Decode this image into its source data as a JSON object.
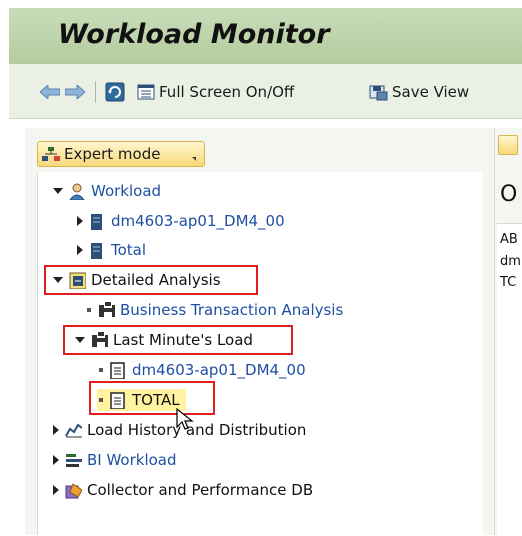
{
  "header": {
    "title": "Workload Monitor"
  },
  "toolbar": {
    "back_icon": "back-arrow-icon",
    "forward_icon": "forward-arrow-icon",
    "fullscreen_label": "Full Screen On/Off",
    "save_view_label": "Save View"
  },
  "expert_mode": {
    "label": "Expert mode"
  },
  "tree": {
    "workload": "Workload",
    "server": "dm4603-ap01_DM4_00",
    "total": "Total",
    "detailed_analysis": "Detailed Analysis",
    "business_transaction": "Business Transaction Analysis",
    "last_minute": "Last Minute's Load",
    "lm_server": "dm4603-ap01_DM4_00",
    "lm_total": "TOTAL",
    "load_history": "Load History and Distribution",
    "bi_workload": "BI Workload",
    "collector": "Collector and Performance DB"
  },
  "right_pane": {
    "title": "O",
    "rows": [
      "AB",
      "dm",
      "TC"
    ]
  },
  "colors": {
    "highlight": "#e02020",
    "link": "#1f4fa3",
    "header": "#c1d6b0"
  }
}
